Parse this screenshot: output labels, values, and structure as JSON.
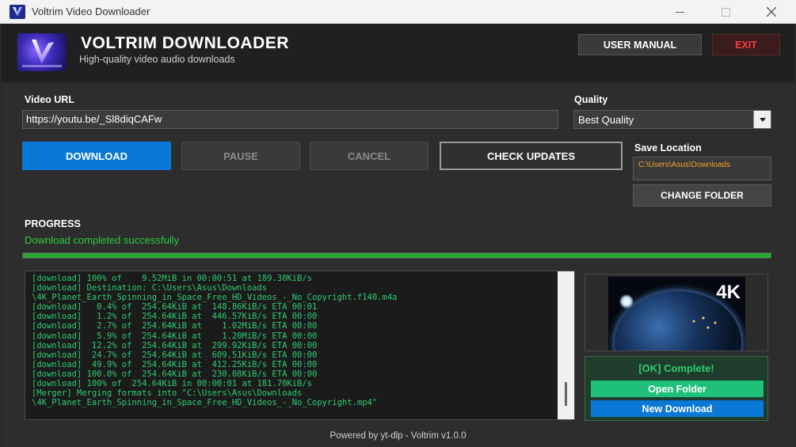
{
  "window": {
    "title": "Voltrim Video Downloader"
  },
  "header": {
    "app_name": "VOLTRIM DOWNLOADER",
    "tagline": "High-quality video  audio downloads",
    "manual_label": "USER MANUAL",
    "exit_label": "EXIT"
  },
  "url": {
    "label": "Video URL",
    "value": "https://youtu.be/_Sl8diqCAFw"
  },
  "quality": {
    "label": "Quality",
    "value": "Best Quality"
  },
  "actions": {
    "download": "DOWNLOAD",
    "pause": "PAUSE",
    "cancel": "CANCEL",
    "check_updates": "CHECK UPDATES"
  },
  "save": {
    "label": "Save Location",
    "path": "C:\\Users\\Asus\\Downloads",
    "change_label": "CHANGE FOLDER"
  },
  "progress": {
    "label": "PROGRESS",
    "status": "Download completed successfully",
    "percent": 100
  },
  "log": {
    "lines": [
      "[download] 100% of    9.52MiB in 00:00:51 at 189.30KiB/s",
      "[download] Destination: C:\\Users\\Asus\\Downloads",
      "\\4K_Planet_Earth_Spinning_in_Space_Free_HD_Videos_-_No_Copyright.f140.m4a",
      "[download]   0.4% of  254.64KiB at  148.86KiB/s ETA 00:01",
      "[download]   1.2% of  254.64KiB at  446.57KiB/s ETA 00:00",
      "[download]   2.7% of  254.64KiB at    1.02MiB/s ETA 00:00",
      "[download]   5.9% of  254.64KiB at    1.20MiB/s ETA 00:00",
      "[download]  12.2% of  254.64KiB at  299.92KiB/s ETA 00:00",
      "[download]  24.7% of  254.64KiB at  609.51KiB/s ETA 00:00",
      "[download]  49.9% of  254.64KiB at  412.25KiB/s ETA 00:00",
      "[download] 100.0% of  254.64KiB at  230.08KiB/s ETA 00:00",
      "[download] 100% of  254.64KiB in 00:00:01 at 181.70KiB/s",
      "[Merger] Merging formats into \"C:\\Users\\Asus\\Downloads",
      "\\4K_Planet_Earth_Spinning_in_Space_Free_HD_Videos_-_No_Copyright.mp4\""
    ]
  },
  "thumbnail": {
    "badge": "4K"
  },
  "completion": {
    "message": "[OK] Complete!",
    "open_label": "Open Folder",
    "new_label": "New Download"
  },
  "footer": {
    "text": "Powered by yt-dlp - Voltrim v1.0.0"
  },
  "colors": {
    "accent_blue": "#0a78d7",
    "success_green": "#2ecc71",
    "exit_red": "#ff3b3b",
    "path_orange": "#f0a030"
  },
  "icons": {
    "app": "voltrim-logo-icon",
    "minimize": "minimize-icon",
    "maximize": "maximize-icon",
    "close": "close-icon",
    "dropdown": "chevron-down-icon"
  }
}
